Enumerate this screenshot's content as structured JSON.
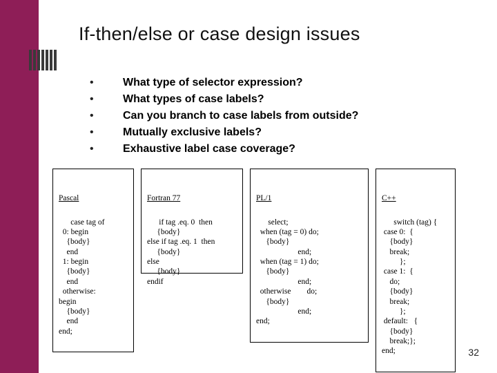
{
  "title": "If-then/else or case design issues",
  "bullets": [
    "What type of selector expression?",
    "What types of case labels?",
    "Can you branch to case labels from outside?",
    "Mutually exclusive labels?",
    "Exhaustive label case coverage?"
  ],
  "code_boxes": {
    "pascal": {
      "lang": "Pascal",
      "body": "case tag of\n  0: begin\n    {body}\n    end\n  1: begin\n    {body}\n    end\n  otherwise:\nbegin\n    {body}\n    end\nend;"
    },
    "fortran": {
      "lang": "Fortran 77",
      "body": "if tag .eq. 0  then\n     {body}\nelse if tag .eq. 1  then\n     {body}\nelse\n     {body}\nendif"
    },
    "pl1": {
      "lang": "PL/1",
      "body": "select;\n  when (tag = 0) do;\n     {body}\n                     end;\n  when (tag = 1) do;\n     {body}\n                     end;\n  otherwise        do;\n     {body}\n                     end;\nend;"
    },
    "cpp": {
      "lang": "C++",
      "body": "switch (tag) {\n case 0:  {\n    {body}\n    break;\n         };\n case 1:  {\n    do;\n    {body}\n    break;\n         };\n default:   {\n    {body}\n    break;};\nend;"
    }
  },
  "page_number": "32"
}
